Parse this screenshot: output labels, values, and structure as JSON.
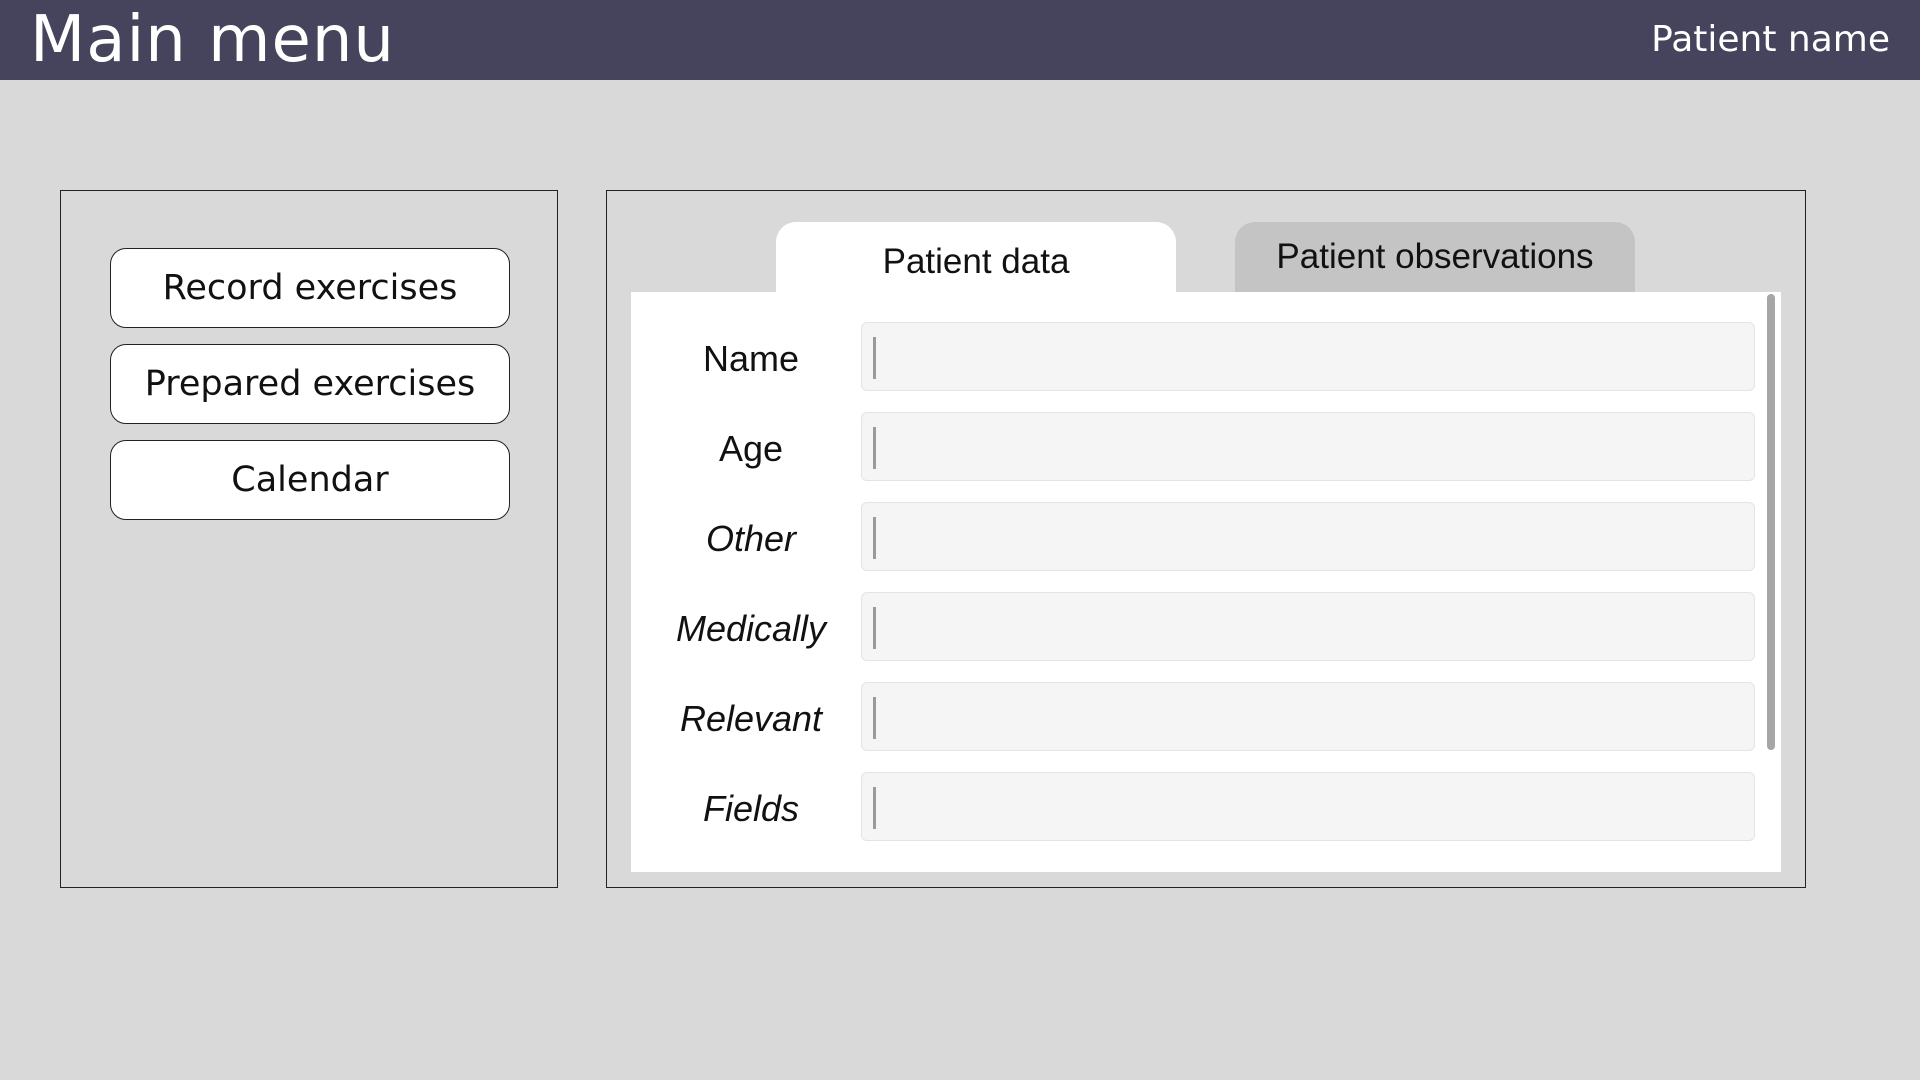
{
  "header": {
    "title": "Main menu",
    "patient_name": "Patient name"
  },
  "menu": {
    "buttons": [
      {
        "label": "Record exercises"
      },
      {
        "label": "Prepared exercises"
      },
      {
        "label": "Calendar"
      }
    ]
  },
  "tabs": [
    {
      "label": "Patient data",
      "active": true
    },
    {
      "label": "Patient observations",
      "active": false
    }
  ],
  "form": {
    "fields": [
      {
        "label": "Name",
        "value": ""
      },
      {
        "label": "Age",
        "value": ""
      },
      {
        "label": "Other",
        "value": ""
      },
      {
        "label": "Medically",
        "value": ""
      },
      {
        "label": "Relevant",
        "value": ""
      },
      {
        "label": "Fields",
        "value": ""
      }
    ]
  },
  "colors": {
    "header_bg": "#46445c",
    "page_bg": "#d9d9d9",
    "inactive_tab": "#c4c4c4",
    "field_bg": "#f5f5f5"
  }
}
